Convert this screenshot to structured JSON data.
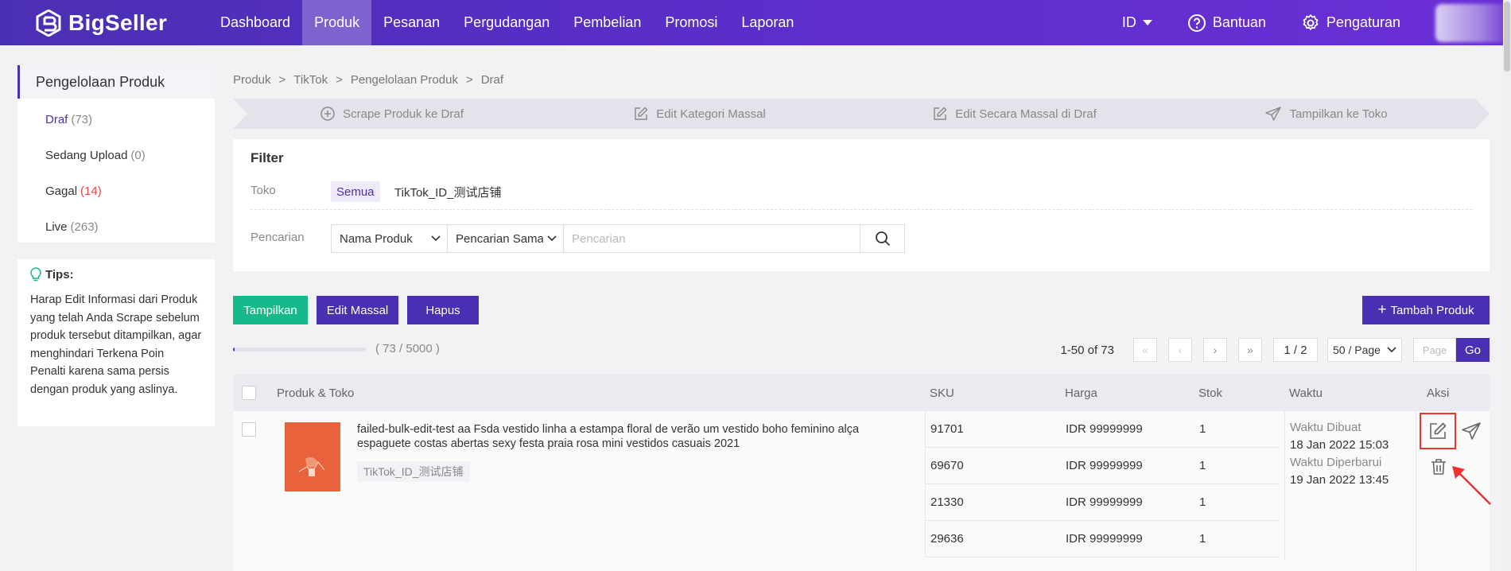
{
  "app": {
    "brand": "BigSeller",
    "nav": [
      "Dashboard",
      "Produk",
      "Pesanan",
      "Pergudangan",
      "Pembelian",
      "Promosi",
      "Laporan"
    ],
    "active_nav": "Produk",
    "lang": "ID",
    "help": "Bantuan",
    "settings": "Pengaturan"
  },
  "sidebar": {
    "title": "Pengelolaan Produk",
    "items": [
      {
        "label": "Draf",
        "count": "(73)"
      },
      {
        "label": "Sedang Upload",
        "count": "(0)"
      },
      {
        "label": "Gagal",
        "count": "(14)"
      },
      {
        "label": "Live",
        "count": "(263)"
      }
    ],
    "tips_title": "Tips:",
    "tips_text": "Harap Edit Informasi dari Produk yang telah Anda Scrape sebelum produk tersebut ditampilkan, agar menghindari Terkena Poin Penalti karena sama persis dengan produk yang aslinya."
  },
  "breadcrumb": [
    "Produk",
    "TikTok",
    "Pengelolaan Produk",
    "Draf"
  ],
  "steps": [
    "Scrape Produk ke Draf",
    "Edit Kategori Massal",
    "Edit Secara Massal di Draf",
    "Tampilkan ke Toko"
  ],
  "filter": {
    "title": "Filter",
    "toko_label": "Toko",
    "toko_all": "Semua",
    "toko_shop": "TikTok_ID_测试店铺",
    "search_label": "Pencarian",
    "field_select": "Nama Produk",
    "mode_select": "Pencarian Sama",
    "search_placeholder": "Pencarian"
  },
  "actions": {
    "show": "Tampilkan",
    "bulk_edit": "Edit Massal",
    "delete": "Hapus",
    "add_product": "Tambah Produk"
  },
  "quota": {
    "text": "( 73 / 5000 )",
    "used": 73,
    "total": 5000
  },
  "pager": {
    "range": "1-50 of 73",
    "page": "1 / 2",
    "size": "50 / Page",
    "page_placeholder": "Page",
    "go": "Go"
  },
  "table": {
    "headers": {
      "product": "Produk & Toko",
      "sku": "SKU",
      "price": "Harga",
      "stock": "Stok",
      "time": "Waktu",
      "action": "Aksi"
    },
    "row": {
      "title": "failed-bulk-edit-test aa Fsda vestido linha a estampa floral de verão um vestido boho feminino alça espaguete costas abertas sexy festa praia rosa mini vestidos casuais 2021",
      "shop": "TikTok_ID_测试店铺",
      "variants": [
        {
          "sku": "91701",
          "price": "IDR 99999999",
          "stock": "1"
        },
        {
          "sku": "69670",
          "price": "IDR 99999999",
          "stock": "1"
        },
        {
          "sku": "21330",
          "price": "IDR 99999999",
          "stock": "1"
        },
        {
          "sku": "29636",
          "price": "IDR 99999999",
          "stock": "1"
        }
      ],
      "created_label": "Waktu Dibuat",
      "created": "18 Jan 2022 15:03",
      "updated_label": "Waktu Diperbarui",
      "updated": "19 Jan 2022 13:45"
    }
  },
  "colors": {
    "primary": "#4b2fb3",
    "green": "#15b98a",
    "danger": "#e84545"
  }
}
